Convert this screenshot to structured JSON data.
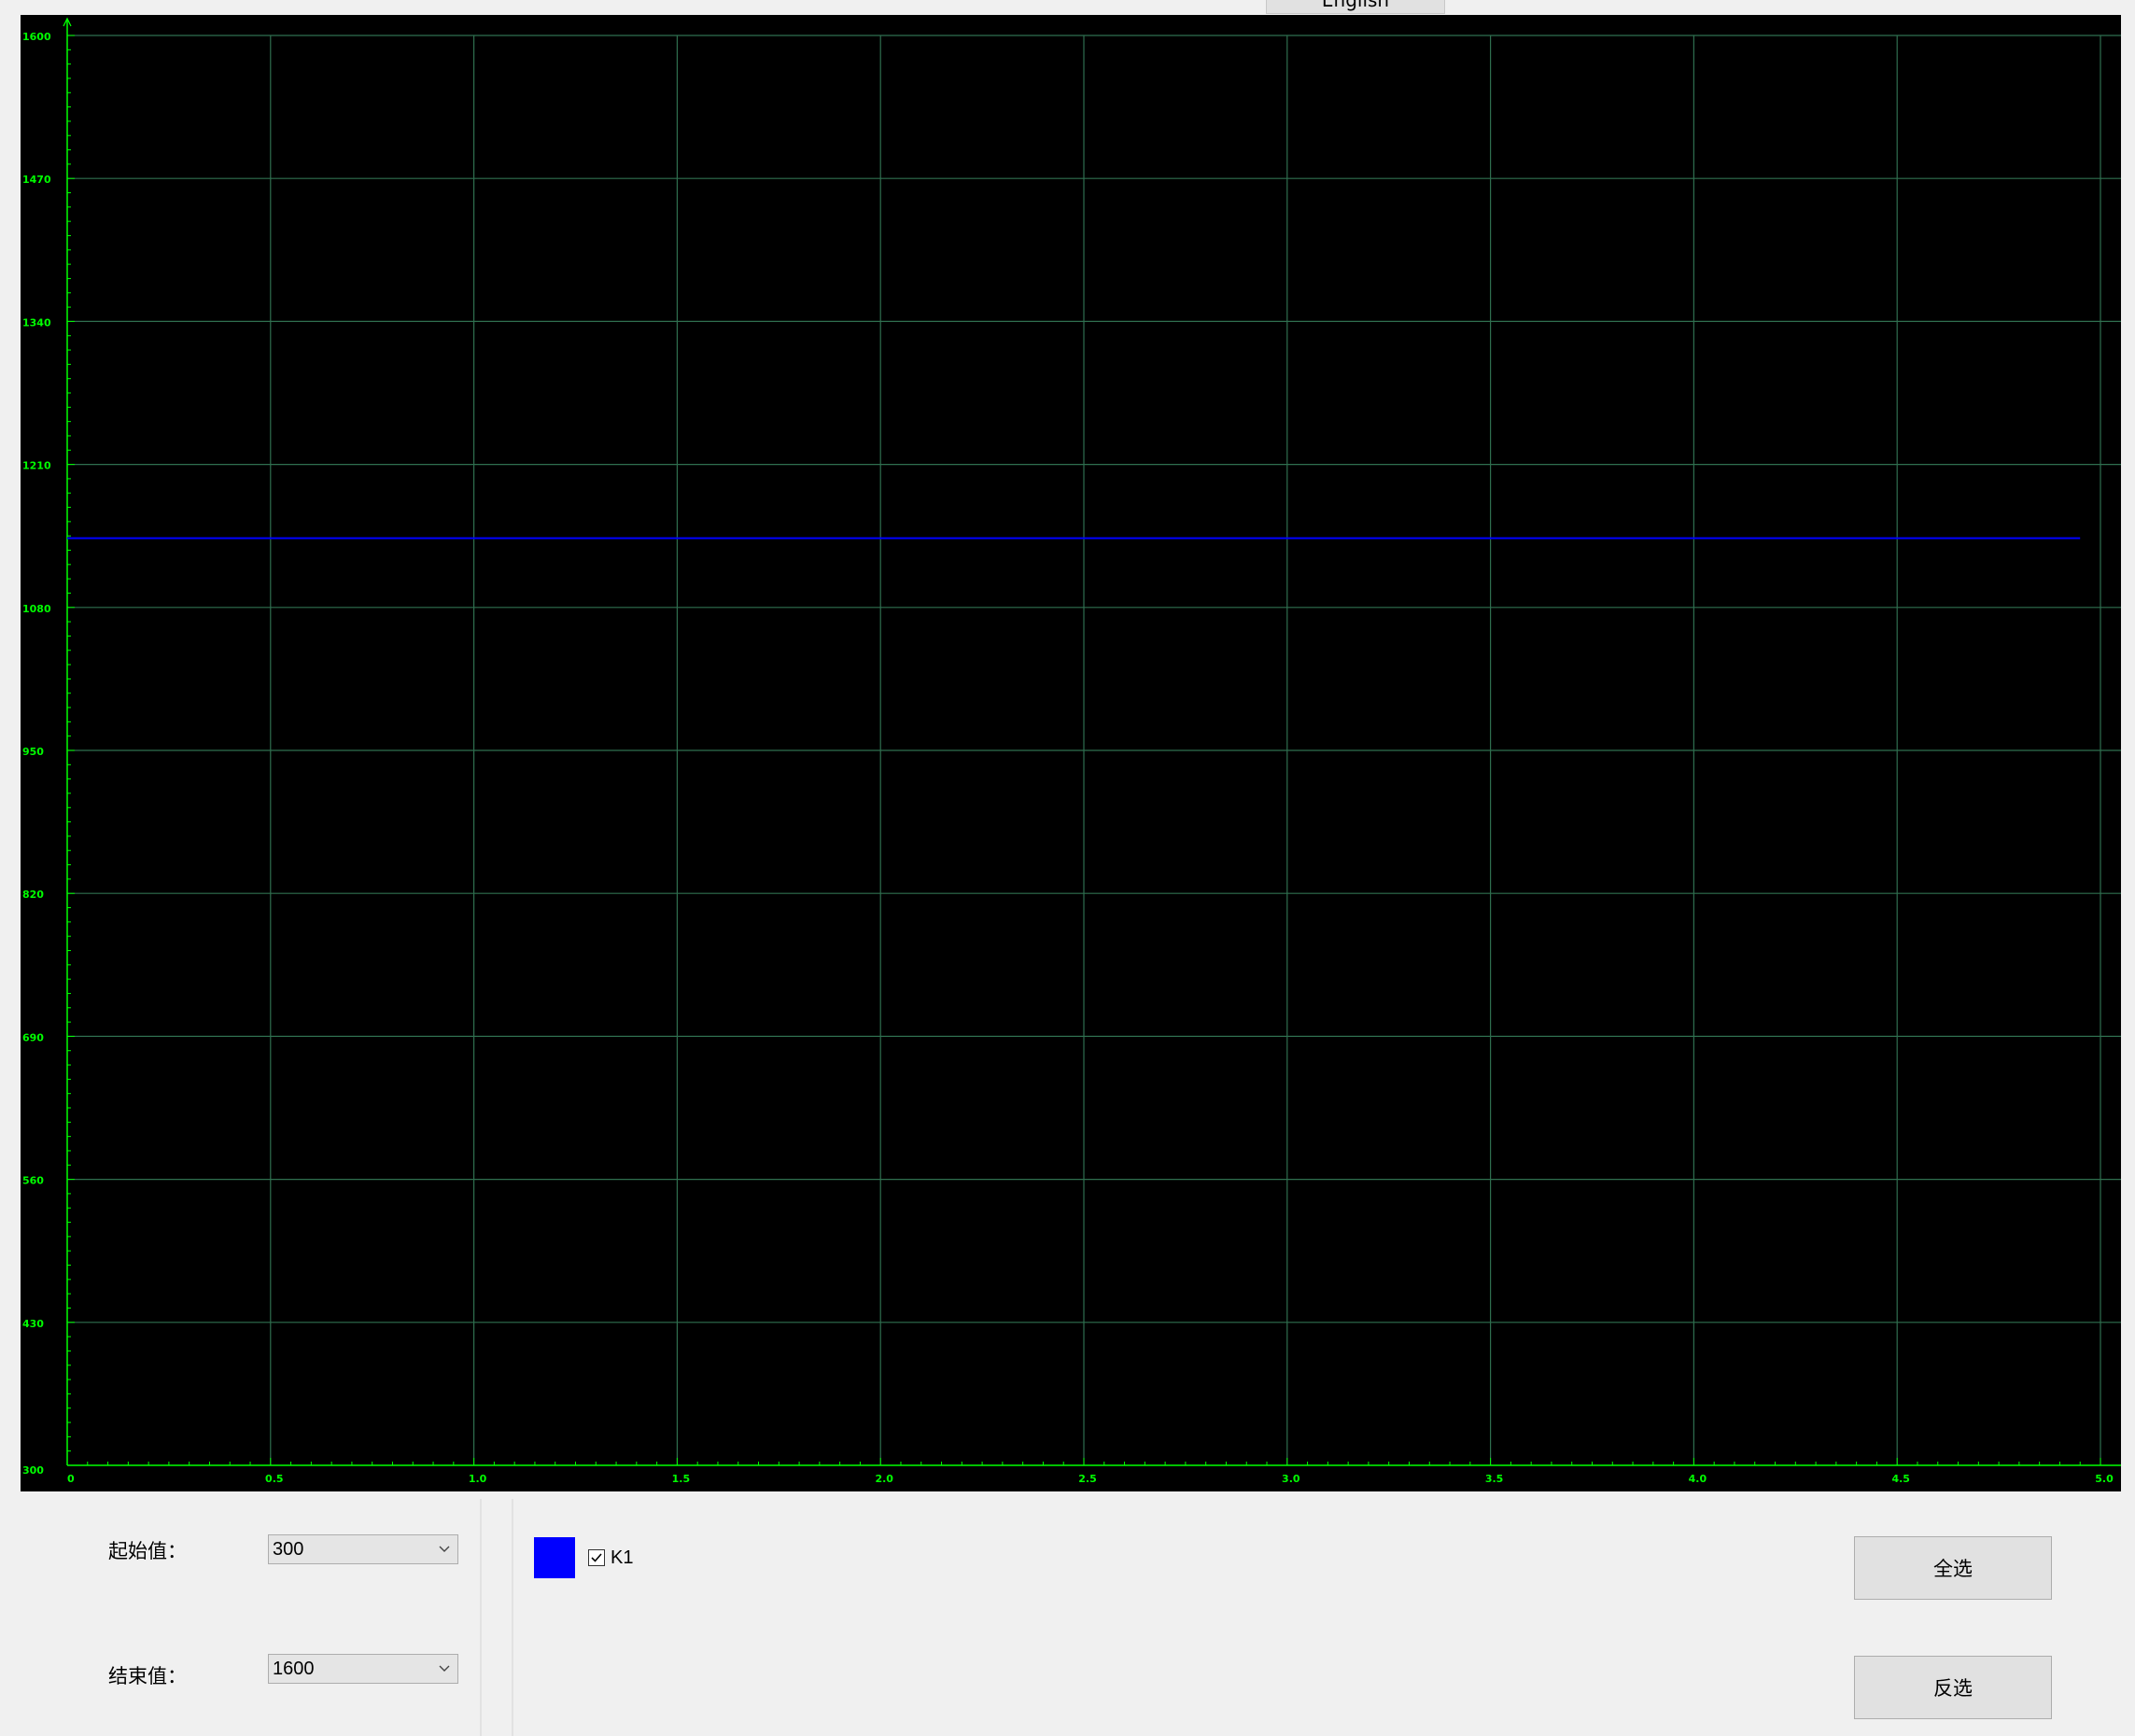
{
  "header": {
    "language_tab": "English"
  },
  "chart_data": {
    "type": "line",
    "xlim": [
      0,
      5.0
    ],
    "ylim": [
      300,
      1600
    ],
    "x_ticks": [
      "0",
      "0.5",
      "1.0",
      "1.5",
      "2.0",
      "2.5",
      "3.0",
      "3.5",
      "4.0",
      "4.5",
      "5.0"
    ],
    "y_ticks": [
      "1600",
      "1470",
      "1340",
      "1210",
      "1080",
      "950",
      "820",
      "690",
      "560",
      "430",
      "300"
    ],
    "grid": true,
    "colors": {
      "background": "#000000",
      "axis": "#00ff00",
      "grid": "#2f6f4f",
      "series": "#0000ff"
    },
    "series": [
      {
        "name": "K1",
        "x": [
          0,
          0.5,
          1.0,
          1.5,
          2.0,
          2.5,
          3.0,
          3.5,
          4.0,
          4.5,
          4.95
        ],
        "values": [
          1143,
          1143,
          1143,
          1143,
          1143,
          1143,
          1143,
          1143,
          1143,
          1143,
          1143
        ]
      }
    ]
  },
  "controls": {
    "start_label": "起始值：",
    "start_value": "300",
    "end_label": "结束值：",
    "end_value": "1600"
  },
  "legend": {
    "items": [
      {
        "label": "K1",
        "color": "#0000ff",
        "checked": true
      }
    ]
  },
  "buttons": {
    "select_all": "全选",
    "invert": "反选"
  }
}
